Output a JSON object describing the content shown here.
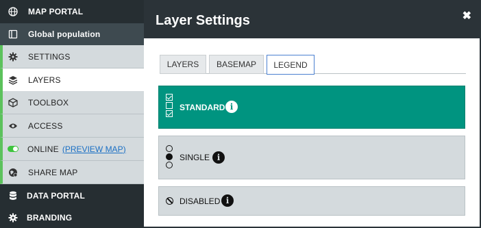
{
  "sidebar": {
    "map_portal": "MAP PORTAL",
    "global_population": "Global population",
    "settings": "SETTINGS",
    "layers": "LAYERS",
    "toolbox": "TOOLBOX",
    "access": "ACCESS",
    "online": "ONLINE",
    "preview_map": "(PREVIEW MAP)",
    "share_map": "SHARE MAP",
    "data_portal": "DATA PORTAL",
    "branding": "BRANDING"
  },
  "panel": {
    "title": "Layer Settings",
    "close": "✖",
    "tabs": [
      "LAYERS",
      "BASEMAP",
      "LEGEND"
    ],
    "active_tab": "LEGEND",
    "options": {
      "standard": "STANDARD",
      "single": "SINGLE",
      "disabled": "DISABLED"
    },
    "info": "i"
  },
  "colors": {
    "accent_green": "#5cc25c",
    "standard_teal": "#009480",
    "sidebar_dark": "#2b3338",
    "tab_border": "#4a7fd0"
  }
}
